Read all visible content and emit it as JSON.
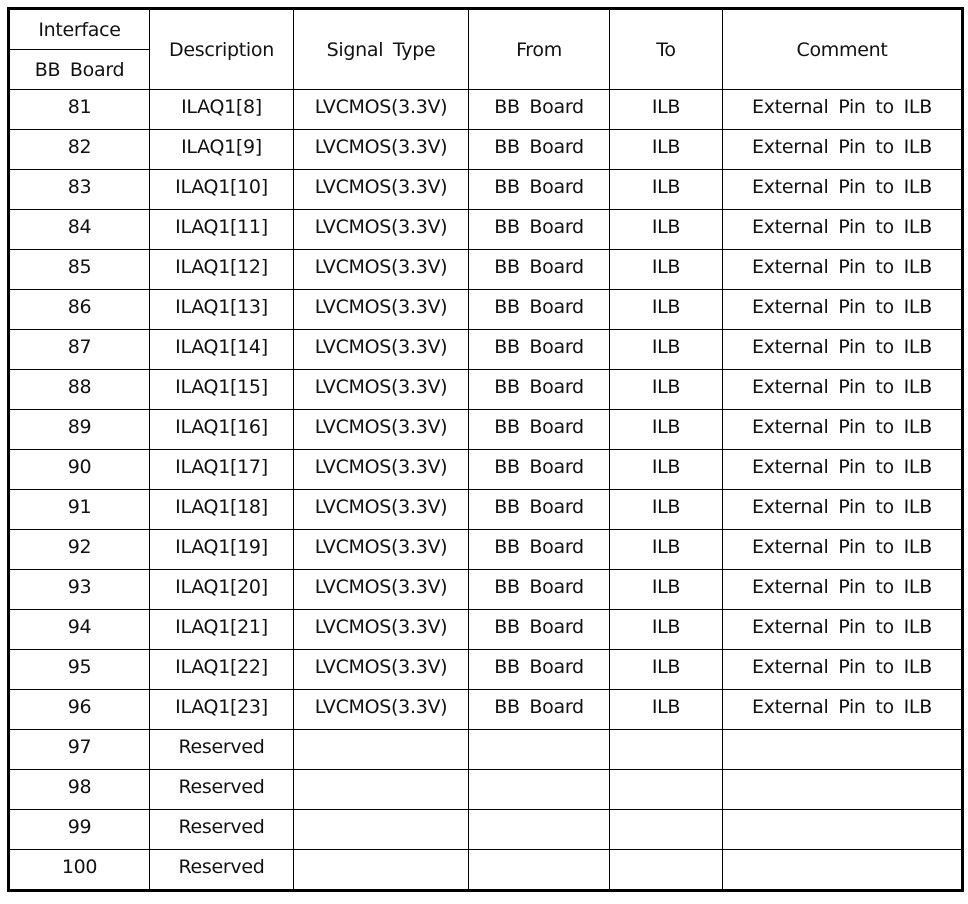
{
  "table": {
    "headers": {
      "interface": "Interface",
      "bb_board": "BB  Board",
      "description": "Description",
      "signal_type": "Signal  Type",
      "from": "From",
      "to": "To",
      "comment": "Comment"
    },
    "rows": [
      {
        "pin": "81",
        "description": "ILAQ1[8]",
        "signal_type": "LVCMOS(3.3V)",
        "from": "BB  Board",
        "to": "ILB",
        "comment": "External  Pin  to  ILB"
      },
      {
        "pin": "82",
        "description": "ILAQ1[9]",
        "signal_type": "LVCMOS(3.3V)",
        "from": "BB  Board",
        "to": "ILB",
        "comment": "External  Pin  to  ILB"
      },
      {
        "pin": "83",
        "description": "ILAQ1[10]",
        "signal_type": "LVCMOS(3.3V)",
        "from": "BB  Board",
        "to": "ILB",
        "comment": "External  Pin  to  ILB"
      },
      {
        "pin": "84",
        "description": "ILAQ1[11]",
        "signal_type": "LVCMOS(3.3V)",
        "from": "BB  Board",
        "to": "ILB",
        "comment": "External  Pin  to  ILB"
      },
      {
        "pin": "85",
        "description": "ILAQ1[12]",
        "signal_type": "LVCMOS(3.3V)",
        "from": "BB  Board",
        "to": "ILB",
        "comment": "External  Pin  to  ILB"
      },
      {
        "pin": "86",
        "description": "ILAQ1[13]",
        "signal_type": "LVCMOS(3.3V)",
        "from": "BB  Board",
        "to": "ILB",
        "comment": "External  Pin  to  ILB"
      },
      {
        "pin": "87",
        "description": "ILAQ1[14]",
        "signal_type": "LVCMOS(3.3V)",
        "from": "BB  Board",
        "to": "ILB",
        "comment": "External  Pin  to  ILB"
      },
      {
        "pin": "88",
        "description": "ILAQ1[15]",
        "signal_type": "LVCMOS(3.3V)",
        "from": "BB  Board",
        "to": "ILB",
        "comment": "External  Pin  to  ILB"
      },
      {
        "pin": "89",
        "description": "ILAQ1[16]",
        "signal_type": "LVCMOS(3.3V)",
        "from": "BB  Board",
        "to": "ILB",
        "comment": "External  Pin  to  ILB"
      },
      {
        "pin": "90",
        "description": "ILAQ1[17]",
        "signal_type": "LVCMOS(3.3V)",
        "from": "BB  Board",
        "to": "ILB",
        "comment": "External  Pin  to  ILB"
      },
      {
        "pin": "91",
        "description": "ILAQ1[18]",
        "signal_type": "LVCMOS(3.3V)",
        "from": "BB  Board",
        "to": "ILB",
        "comment": "External  Pin  to  ILB"
      },
      {
        "pin": "92",
        "description": "ILAQ1[19]",
        "signal_type": "LVCMOS(3.3V)",
        "from": "BB  Board",
        "to": "ILB",
        "comment": "External  Pin  to  ILB"
      },
      {
        "pin": "93",
        "description": "ILAQ1[20]",
        "signal_type": "LVCMOS(3.3V)",
        "from": "BB  Board",
        "to": "ILB",
        "comment": "External  Pin  to  ILB"
      },
      {
        "pin": "94",
        "description": "ILAQ1[21]",
        "signal_type": "LVCMOS(3.3V)",
        "from": "BB  Board",
        "to": "ILB",
        "comment": "External  Pin  to  ILB"
      },
      {
        "pin": "95",
        "description": "ILAQ1[22]",
        "signal_type": "LVCMOS(3.3V)",
        "from": "BB  Board",
        "to": "ILB",
        "comment": "External  Pin  to  ILB"
      },
      {
        "pin": "96",
        "description": "ILAQ1[23]",
        "signal_type": "LVCMOS(3.3V)",
        "from": "BB  Board",
        "to": "ILB",
        "comment": "External  Pin  to  ILB"
      },
      {
        "pin": "97",
        "description": "Reserved",
        "signal_type": "",
        "from": "",
        "to": "",
        "comment": ""
      },
      {
        "pin": "98",
        "description": "Reserved",
        "signal_type": "",
        "from": "",
        "to": "",
        "comment": ""
      },
      {
        "pin": "99",
        "description": "Reserved",
        "signal_type": "",
        "from": "",
        "to": "",
        "comment": ""
      },
      {
        "pin": "100",
        "description": "Reserved",
        "signal_type": "",
        "from": "",
        "to": "",
        "comment": ""
      }
    ]
  }
}
